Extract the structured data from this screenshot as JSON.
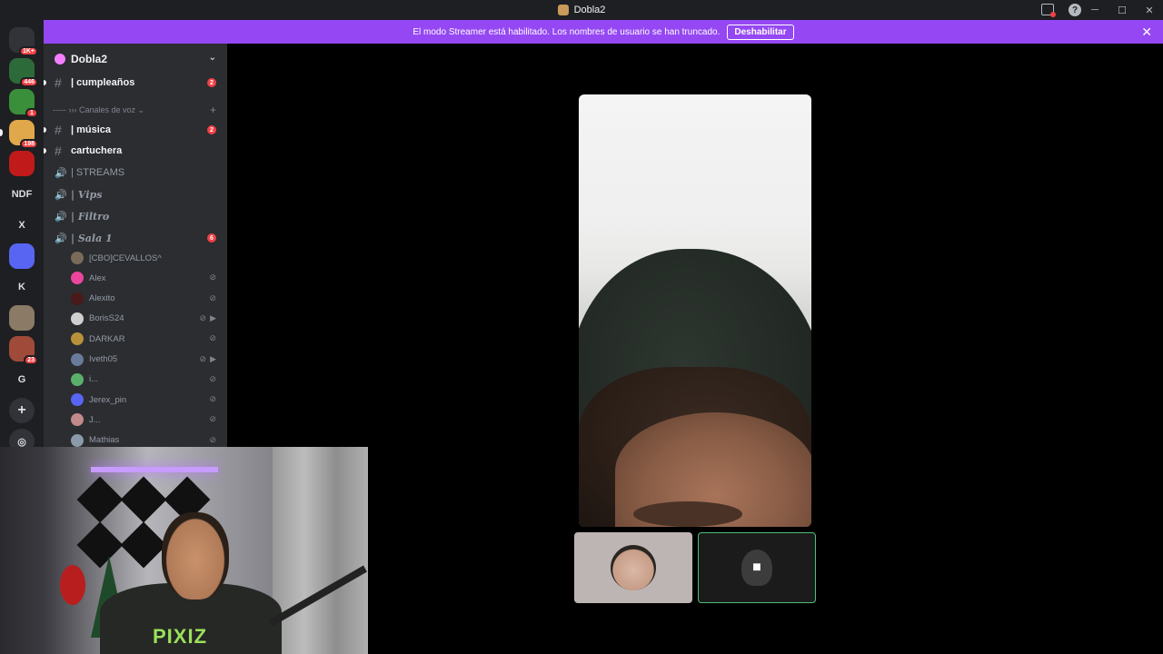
{
  "titlebar": {
    "app_title": "Dobla2"
  },
  "banner": {
    "message": "El modo Streamer está habilitado. Los nombres de usuario se han truncado.",
    "disable_label": "Deshabilitar"
  },
  "rail": {
    "items": [
      {
        "label": "",
        "badge": "1K+",
        "icon": "discord-home-icon",
        "color": "#313338"
      },
      {
        "label": "",
        "badge": "446",
        "icon": "palm-tree-server-icon",
        "color": "#2d6a3a"
      },
      {
        "label": "",
        "badge": "1",
        "icon": "k-server-icon",
        "color": "#3a8f3a"
      },
      {
        "label": "",
        "badge": "198",
        "icon": "dobla2-server-icon",
        "color": "#e0a84a"
      },
      {
        "label": "",
        "badge": "",
        "icon": "spiderman-server-icon",
        "color": "#c01a1a"
      },
      {
        "label": "NDF",
        "badge": ""
      },
      {
        "label": "X",
        "badge": ""
      },
      {
        "label": "",
        "badge": "",
        "icon": "folder-icon",
        "color": "#5865f2"
      },
      {
        "label": "K",
        "badge": ""
      },
      {
        "label": "",
        "badge": "",
        "icon": "speaker-server-icon",
        "color": "#8a7a66"
      },
      {
        "label": "",
        "badge": "23",
        "icon": "avatar-server-icon",
        "color": "#a04a3a"
      },
      {
        "label": "G",
        "badge": ""
      }
    ],
    "add_server_icon": "plus-icon",
    "explore_icon": "compass-icon"
  },
  "sidebar": {
    "server_name": "Dobla2",
    "category_label": "----- ››› Canales de voz ⌄",
    "channels": [
      {
        "name": "| cumpleaños",
        "type": "text",
        "unread": true,
        "count": "2"
      },
      {
        "name": "| música",
        "type": "text",
        "unread": true,
        "count": "2"
      },
      {
        "name": "cartuchera",
        "type": "text",
        "unread": true,
        "count": ""
      },
      {
        "name": "| STREAMS",
        "type": "voice",
        "unread": false,
        "count": ""
      },
      {
        "name": "| 𝑽𝒊𝒑𝒔",
        "type": "voice",
        "unread": false,
        "count": ""
      },
      {
        "name": "| 𝑭𝒊𝒍𝒕𝒓𝒐",
        "type": "voice",
        "unread": false,
        "count": ""
      },
      {
        "name": "| 𝑺𝒂𝒍𝒂 1",
        "type": "voice",
        "unread": false,
        "count": "6"
      }
    ],
    "voice_users": [
      {
        "name": "[CBO]CEVALLOS^",
        "muted": false,
        "video": false,
        "color": "#7a6a5a"
      },
      {
        "name": "Alex",
        "muted": true,
        "video": false,
        "color": "#eb459e"
      },
      {
        "name": "Alexito",
        "muted": true,
        "video": false,
        "color": "#4a1a1a"
      },
      {
        "name": "BorisS24",
        "muted": true,
        "video": true,
        "color": "#d0d0d0"
      },
      {
        "name": "DARKAR",
        "muted": true,
        "video": false,
        "color": "#b8913a"
      },
      {
        "name": "Iveth05",
        "muted": true,
        "video": true,
        "color": "#6a7a9a"
      },
      {
        "name": "i...",
        "muted": true,
        "video": false,
        "color": "#5ab06a"
      },
      {
        "name": "Jerex_pin",
        "muted": true,
        "video": false,
        "color": "#5865f2"
      },
      {
        "name": "J...",
        "muted": true,
        "video": false,
        "color": "#c08a8a"
      },
      {
        "name": "Mathias",
        "muted": true,
        "video": false,
        "color": "#8a9aa8"
      }
    ]
  },
  "stage": {
    "tiles": [
      {
        "kind": "main-video"
      },
      {
        "kind": "participant-avatar"
      },
      {
        "kind": "camera-placeholder"
      }
    ]
  },
  "webcam": {
    "shirt_text": "PIXIZ"
  }
}
